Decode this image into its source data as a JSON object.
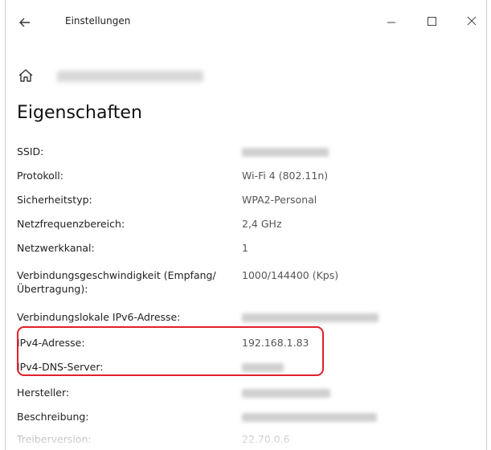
{
  "window": {
    "title": "Einstellungen"
  },
  "header": {
    "network_name": ""
  },
  "page": {
    "title": "Eigenschaften"
  },
  "properties": [
    {
      "label": "SSID:",
      "value": ""
    },
    {
      "label": "Protokoll:",
      "value": "Wi-Fi 4 (802.11n)"
    },
    {
      "label": "Sicherheitstyp:",
      "value": "WPA2-Personal"
    },
    {
      "label": "Netzfrequenzbereich:",
      "value": "2,4 GHz"
    },
    {
      "label": "Netzwerkkanal:",
      "value": "1"
    },
    {
      "label": "Verbindungsgeschwindigkeit (Empfang/Übertragung):",
      "value": "1000/144400 (Kps)"
    },
    {
      "label": "Verbindungslokale IPv6-Adresse:",
      "value": ""
    },
    {
      "label": "IPv4-Adresse:",
      "value": "192.168.1.83"
    },
    {
      "label": "IPv4-DNS-Server:",
      "value": ""
    },
    {
      "label": "Hersteller:",
      "value": ""
    },
    {
      "label": "Beschreibung:",
      "value": ""
    },
    {
      "label": "Treiberversion:",
      "value": "22.70.0.6"
    }
  ],
  "colors": {
    "highlight": "#e0202a"
  },
  "icons": {
    "back": "back-arrow-icon",
    "minimize": "minimize-icon",
    "maximize": "maximize-icon",
    "close": "close-icon",
    "home": "home-icon"
  }
}
